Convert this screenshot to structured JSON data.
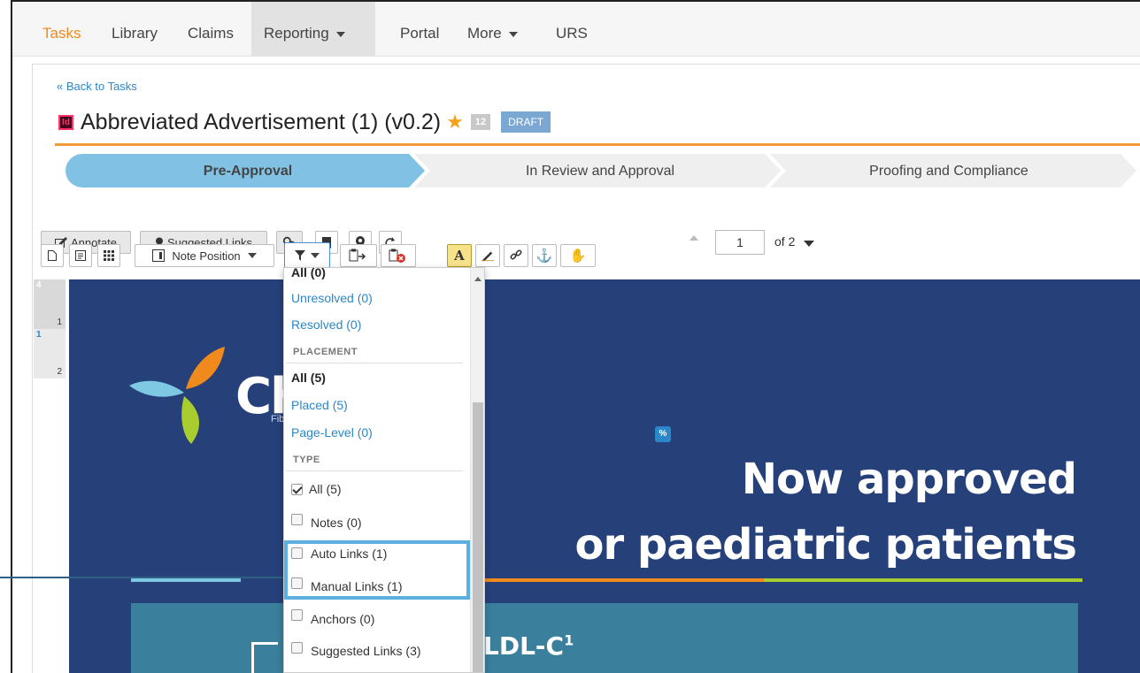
{
  "nav": {
    "items": [
      {
        "label": "Tasks"
      },
      {
        "label": "Library"
      },
      {
        "label": "Claims"
      },
      {
        "label": "Reporting"
      },
      {
        "label": "Portal"
      },
      {
        "label": "More"
      },
      {
        "label": "URS"
      }
    ],
    "active": "Tasks",
    "accent": "#f08a1c"
  },
  "header": {
    "back_link": "« Back to Tasks",
    "file_icon": "Id",
    "title": "Abbreviated Advertisement (1) (v0.2)",
    "count": "12",
    "status": "DRAFT"
  },
  "steps": [
    {
      "label": "Pre-Approval",
      "active": true
    },
    {
      "label": "In Review and Approval",
      "active": false
    },
    {
      "label": "Proofing and Compliance",
      "active": false
    }
  ],
  "toolbar": {
    "annotate_label": "Annotate",
    "suggested_links_label": "Suggested Links",
    "note_position_label": "Note Position",
    "page_current": "1",
    "page_total": "of 2"
  },
  "thumbnails": [
    {
      "badge": "4",
      "page": "1"
    },
    {
      "badge": "1",
      "page": "2"
    }
  ],
  "canvas": {
    "logo_text": "Ch",
    "logo_sub": "Fib",
    "link_badge": "%",
    "headline_1": "Now approved",
    "headline_2": "or paediatric patients",
    "subhead": "LDL-C",
    "subhead_sup": "1",
    "background": "#26407a"
  },
  "filter_menu": {
    "status_items": [
      {
        "label": "All (0)"
      },
      {
        "label": "Unresolved (0)"
      },
      {
        "label": "Resolved (0)"
      }
    ],
    "placement_heading": "PLACEMENT",
    "placement_items": [
      {
        "label": "All (5)"
      },
      {
        "label": "Placed (5)"
      },
      {
        "label": "Page-Level (0)"
      }
    ],
    "type_heading": "TYPE",
    "type_items": [
      {
        "label": "All (5)",
        "checked": true
      },
      {
        "label": "Notes (0)",
        "checked": false
      },
      {
        "label": "Auto Links (1)",
        "checked": false
      },
      {
        "label": "Manual Links (1)",
        "checked": false
      },
      {
        "label": "Anchors (0)",
        "checked": false
      },
      {
        "label": "Suggested Links (3)",
        "checked": false
      }
    ]
  },
  "icons": [
    "filter-icon",
    "bookmark-icon",
    "location-pin-icon",
    "refresh-icon",
    "pencil-icon",
    "link-icon",
    "anchor-icon",
    "hand-icon"
  ]
}
